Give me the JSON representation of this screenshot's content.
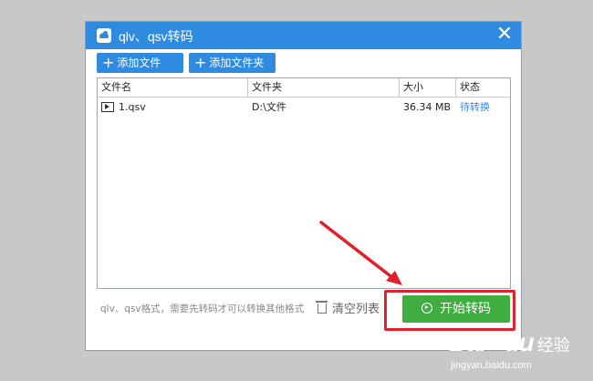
{
  "window": {
    "title": "qlv、qsv转码"
  },
  "toolbar": {
    "add_file_label": "添加文件",
    "add_folder_label": "添加文件夹"
  },
  "table": {
    "columns": [
      "文件名",
      "文件夹",
      "大小",
      "状态"
    ],
    "rows": [
      {
        "name": "1.qsv",
        "folder": "D:\\文件",
        "size": "36.34 MB",
        "status": "待转换"
      }
    ]
  },
  "footer": {
    "hint": "qlv、qsv格式，需要先转码才可以转换其他格式",
    "clear_label": "清空列表",
    "start_label": "开始转码"
  },
  "watermark": {
    "logo": "Bai",
    "logo_end": "du",
    "suffix": "经验",
    "url": "jingyan.baidu.com"
  },
  "colors": {
    "titlebar": "#2f8bdf",
    "start_button": "#3fad3f",
    "highlight": "#e0212b",
    "status_link": "#2f8bdf"
  }
}
